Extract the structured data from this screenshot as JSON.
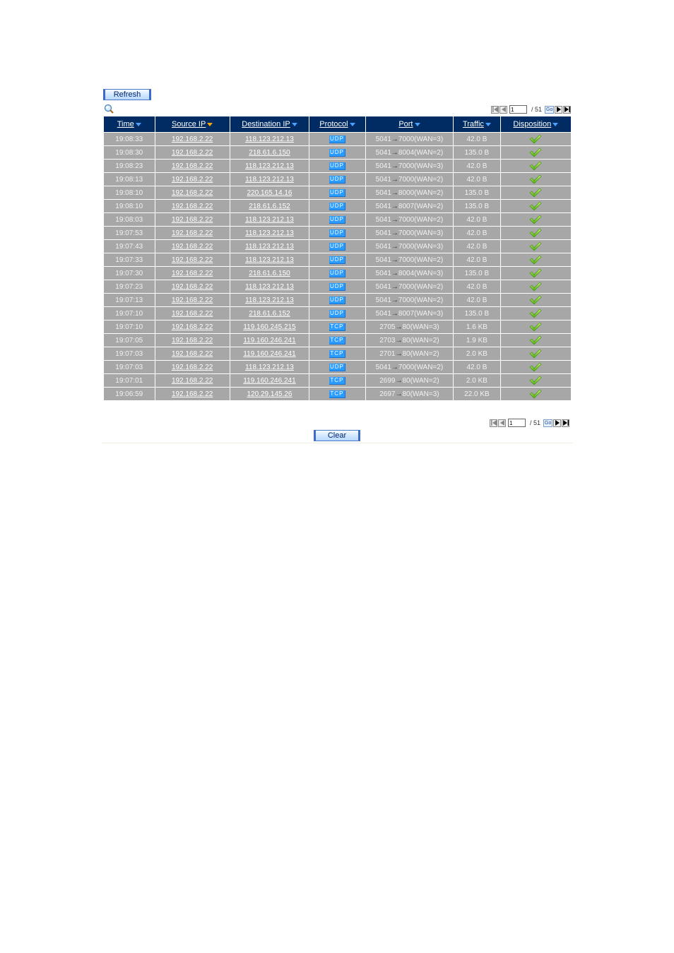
{
  "toolbar": {
    "refresh_label": "Refresh",
    "clear_label": "Clear"
  },
  "pager": {
    "current_page": "1",
    "total_label": "/ 51",
    "go_label": "Go"
  },
  "table": {
    "columns": [
      {
        "label": "Time",
        "sort": "desc"
      },
      {
        "label": "Source IP",
        "sort": "active"
      },
      {
        "label": "Destination IP",
        "sort": "desc"
      },
      {
        "label": "Protocol",
        "sort": "desc"
      },
      {
        "label": "Port",
        "sort": "desc"
      },
      {
        "label": "Traffic",
        "sort": "desc"
      },
      {
        "label": "Disposition",
        "sort": "desc"
      }
    ],
    "rows": [
      {
        "time": "19:08:33",
        "src": "192.168.2.22",
        "dst": "118.123.212.13",
        "proto": "UDP",
        "sport": "5041",
        "dport": "7000(WAN=3)",
        "traffic": "42.0 B",
        "disposition": "allow"
      },
      {
        "time": "19:08:30",
        "src": "192.168.2.22",
        "dst": "218.61.6.150",
        "proto": "UDP",
        "sport": "5041",
        "dport": "8004(WAN=2)",
        "traffic": "135.0 B",
        "disposition": "allow"
      },
      {
        "time": "19:08:23",
        "src": "192.168.2.22",
        "dst": "118.123.212.13",
        "proto": "UDP",
        "sport": "5041",
        "dport": "7000(WAN=3)",
        "traffic": "42.0 B",
        "disposition": "allow"
      },
      {
        "time": "19:08:13",
        "src": "192.168.2.22",
        "dst": "118.123.212.13",
        "proto": "UDP",
        "sport": "5041",
        "dport": "7000(WAN=2)",
        "traffic": "42.0 B",
        "disposition": "allow"
      },
      {
        "time": "19:08:10",
        "src": "192.168.2.22",
        "dst": "220.165.14.16",
        "proto": "UDP",
        "sport": "5041",
        "dport": "8000(WAN=2)",
        "traffic": "135.0 B",
        "disposition": "allow"
      },
      {
        "time": "19:08:10",
        "src": "192.168.2.22",
        "dst": "218.61.6.152",
        "proto": "UDP",
        "sport": "5041",
        "dport": "8007(WAN=2)",
        "traffic": "135.0 B",
        "disposition": "allow"
      },
      {
        "time": "19:08:03",
        "src": "192.168.2.22",
        "dst": "118.123.212.13",
        "proto": "UDP",
        "sport": "5041",
        "dport": "7000(WAN=2)",
        "traffic": "42.0 B",
        "disposition": "allow"
      },
      {
        "time": "19:07:53",
        "src": "192.168.2.22",
        "dst": "118.123.212.13",
        "proto": "UDP",
        "sport": "5041",
        "dport": "7000(WAN=3)",
        "traffic": "42.0 B",
        "disposition": "allow"
      },
      {
        "time": "19:07:43",
        "src": "192.168.2.22",
        "dst": "118.123.212.13",
        "proto": "UDP",
        "sport": "5041",
        "dport": "7000(WAN=3)",
        "traffic": "42.0 B",
        "disposition": "allow"
      },
      {
        "time": "19:07:33",
        "src": "192.168.2.22",
        "dst": "118.123.212.13",
        "proto": "UDP",
        "sport": "5041",
        "dport": "7000(WAN=2)",
        "traffic": "42.0 B",
        "disposition": "allow"
      },
      {
        "time": "19:07:30",
        "src": "192.168.2.22",
        "dst": "218.61.6.150",
        "proto": "UDP",
        "sport": "5041",
        "dport": "8004(WAN=3)",
        "traffic": "135.0 B",
        "disposition": "allow"
      },
      {
        "time": "19:07:23",
        "src": "192.168.2.22",
        "dst": "118.123.212.13",
        "proto": "UDP",
        "sport": "5041",
        "dport": "7000(WAN=2)",
        "traffic": "42.0 B",
        "disposition": "allow"
      },
      {
        "time": "19:07:13",
        "src": "192.168.2.22",
        "dst": "118.123.212.13",
        "proto": "UDP",
        "sport": "5041",
        "dport": "7000(WAN=2)",
        "traffic": "42.0 B",
        "disposition": "allow"
      },
      {
        "time": "19:07:10",
        "src": "192.168.2.22",
        "dst": "218.61.6.152",
        "proto": "UDP",
        "sport": "5041",
        "dport": "8007(WAN=3)",
        "traffic": "135.0 B",
        "disposition": "allow"
      },
      {
        "time": "19:07:10",
        "src": "192.168.2.22",
        "dst": "119.160.245.215",
        "proto": "TCP",
        "sport": "2705",
        "dport": "80(WAN=3)",
        "traffic": "1.6 KB",
        "disposition": "allow"
      },
      {
        "time": "19:07:05",
        "src": "192.168.2.22",
        "dst": "119.160.246.241",
        "proto": "TCP",
        "sport": "2703",
        "dport": "80(WAN=2)",
        "traffic": "1.9 KB",
        "disposition": "allow"
      },
      {
        "time": "19:07:03",
        "src": "192.168.2.22",
        "dst": "119.160.246.241",
        "proto": "TCP",
        "sport": "2701",
        "dport": "80(WAN=2)",
        "traffic": "2.0 KB",
        "disposition": "allow"
      },
      {
        "time": "19:07:03",
        "src": "192.168.2.22",
        "dst": "118.123.212.13",
        "proto": "UDP",
        "sport": "5041",
        "dport": "7000(WAN=2)",
        "traffic": "42.0 B",
        "disposition": "allow"
      },
      {
        "time": "19:07:01",
        "src": "192.168.2.22",
        "dst": "119.160.246.241",
        "proto": "TCP",
        "sport": "2699",
        "dport": "80(WAN=2)",
        "traffic": "2.0 KB",
        "disposition": "allow"
      },
      {
        "time": "19:06:59",
        "src": "192.168.2.22",
        "dst": "120.29.145.26",
        "proto": "TCP",
        "sport": "2697",
        "dport": "80(WAN=3)",
        "traffic": "22.0 KB",
        "disposition": "allow"
      }
    ]
  },
  "icons": {
    "search": "magnifier-icon",
    "first": "first-page-icon",
    "prev": "prev-page-icon",
    "next": "next-page-icon",
    "last": "last-page-icon",
    "sort": "sort-down-icon",
    "allow": "check-icon"
  },
  "colors": {
    "header_bg": "#002c63",
    "row_bg": "#a7a7a7",
    "protocol_badge": "#2a9bff",
    "sort_arrow": "#4aa0ff",
    "sort_arrow_active": "#f7a800",
    "check": "#7ed321"
  }
}
